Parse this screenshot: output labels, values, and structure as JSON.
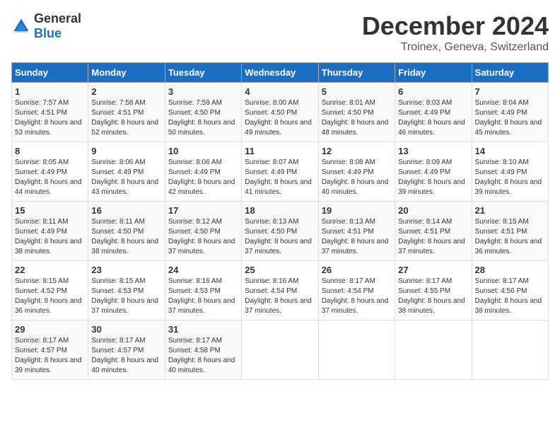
{
  "logo": {
    "general": "General",
    "blue": "Blue"
  },
  "title": "December 2024",
  "location": "Troinex, Geneva, Switzerland",
  "days_of_week": [
    "Sunday",
    "Monday",
    "Tuesday",
    "Wednesday",
    "Thursday",
    "Friday",
    "Saturday"
  ],
  "weeks": [
    [
      {
        "day": "1",
        "sunrise": "7:57 AM",
        "sunset": "4:51 PM",
        "daylight": "8 hours and 53 minutes."
      },
      {
        "day": "2",
        "sunrise": "7:58 AM",
        "sunset": "4:51 PM",
        "daylight": "8 hours and 52 minutes."
      },
      {
        "day": "3",
        "sunrise": "7:59 AM",
        "sunset": "4:50 PM",
        "daylight": "8 hours and 50 minutes."
      },
      {
        "day": "4",
        "sunrise": "8:00 AM",
        "sunset": "4:50 PM",
        "daylight": "8 hours and 49 minutes."
      },
      {
        "day": "5",
        "sunrise": "8:01 AM",
        "sunset": "4:50 PM",
        "daylight": "8 hours and 48 minutes."
      },
      {
        "day": "6",
        "sunrise": "8:03 AM",
        "sunset": "4:49 PM",
        "daylight": "8 hours and 46 minutes."
      },
      {
        "day": "7",
        "sunrise": "8:04 AM",
        "sunset": "4:49 PM",
        "daylight": "8 hours and 45 minutes."
      }
    ],
    [
      {
        "day": "8",
        "sunrise": "8:05 AM",
        "sunset": "4:49 PM",
        "daylight": "8 hours and 44 minutes."
      },
      {
        "day": "9",
        "sunrise": "8:06 AM",
        "sunset": "4:49 PM",
        "daylight": "8 hours and 43 minutes."
      },
      {
        "day": "10",
        "sunrise": "8:06 AM",
        "sunset": "4:49 PM",
        "daylight": "8 hours and 42 minutes."
      },
      {
        "day": "11",
        "sunrise": "8:07 AM",
        "sunset": "4:49 PM",
        "daylight": "8 hours and 41 minutes."
      },
      {
        "day": "12",
        "sunrise": "8:08 AM",
        "sunset": "4:49 PM",
        "daylight": "8 hours and 40 minutes."
      },
      {
        "day": "13",
        "sunrise": "8:09 AM",
        "sunset": "4:49 PM",
        "daylight": "8 hours and 39 minutes."
      },
      {
        "day": "14",
        "sunrise": "8:10 AM",
        "sunset": "4:49 PM",
        "daylight": "8 hours and 39 minutes."
      }
    ],
    [
      {
        "day": "15",
        "sunrise": "8:11 AM",
        "sunset": "4:49 PM",
        "daylight": "8 hours and 38 minutes."
      },
      {
        "day": "16",
        "sunrise": "8:11 AM",
        "sunset": "4:50 PM",
        "daylight": "8 hours and 38 minutes."
      },
      {
        "day": "17",
        "sunrise": "8:12 AM",
        "sunset": "4:50 PM",
        "daylight": "8 hours and 37 minutes."
      },
      {
        "day": "18",
        "sunrise": "8:13 AM",
        "sunset": "4:50 PM",
        "daylight": "8 hours and 37 minutes."
      },
      {
        "day": "19",
        "sunrise": "8:13 AM",
        "sunset": "4:51 PM",
        "daylight": "8 hours and 37 minutes."
      },
      {
        "day": "20",
        "sunrise": "8:14 AM",
        "sunset": "4:51 PM",
        "daylight": "8 hours and 37 minutes."
      },
      {
        "day": "21",
        "sunrise": "8:15 AM",
        "sunset": "4:51 PM",
        "daylight": "8 hours and 36 minutes."
      }
    ],
    [
      {
        "day": "22",
        "sunrise": "8:15 AM",
        "sunset": "4:52 PM",
        "daylight": "8 hours and 36 minutes."
      },
      {
        "day": "23",
        "sunrise": "8:15 AM",
        "sunset": "4:53 PM",
        "daylight": "8 hours and 37 minutes."
      },
      {
        "day": "24",
        "sunrise": "8:16 AM",
        "sunset": "4:53 PM",
        "daylight": "8 hours and 37 minutes."
      },
      {
        "day": "25",
        "sunrise": "8:16 AM",
        "sunset": "4:54 PM",
        "daylight": "8 hours and 37 minutes."
      },
      {
        "day": "26",
        "sunrise": "8:17 AM",
        "sunset": "4:54 PM",
        "daylight": "8 hours and 37 minutes."
      },
      {
        "day": "27",
        "sunrise": "8:17 AM",
        "sunset": "4:55 PM",
        "daylight": "8 hours and 38 minutes."
      },
      {
        "day": "28",
        "sunrise": "8:17 AM",
        "sunset": "4:56 PM",
        "daylight": "8 hours and 38 minutes."
      }
    ],
    [
      {
        "day": "29",
        "sunrise": "8:17 AM",
        "sunset": "4:57 PM",
        "daylight": "8 hours and 39 minutes."
      },
      {
        "day": "30",
        "sunrise": "8:17 AM",
        "sunset": "4:57 PM",
        "daylight": "8 hours and 40 minutes."
      },
      {
        "day": "31",
        "sunrise": "8:17 AM",
        "sunset": "4:58 PM",
        "daylight": "8 hours and 40 minutes."
      },
      null,
      null,
      null,
      null
    ]
  ]
}
